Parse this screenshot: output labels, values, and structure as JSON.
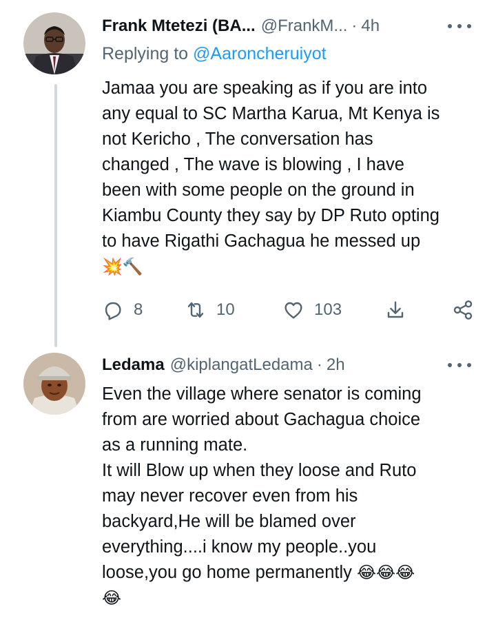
{
  "tweets": [
    {
      "display_name": "Frank Mtetezi (BA...",
      "handle": "@FrankM...",
      "separator": "·",
      "time": "4h",
      "reply_prefix": "Replying to ",
      "reply_to": "@Aaroncheruiyot",
      "text": "Jamaa you are speaking as if you are into\nany equal to SC Martha Karua, Mt Kenya is\nnot Kericho , The conversation has\nchanged , The wave is blowing , I have\nbeen with some people on the ground in\nKiambu County they say by DP Ruto opting\nto have Rigathi Gachagua he messed up",
      "emoji": "💥🔨",
      "replies": "8",
      "retweets": "10",
      "likes": "103"
    },
    {
      "display_name": "Ledama",
      "handle": "@kiplangatLedama",
      "separator": "·",
      "time": "2h",
      "text": "Even the village where senator is coming\nfrom are worried about Gachagua choice\nas a running mate.\nIt will Blow up when they loose and Ruto\nmay never recover even from his\nbackyard,He will be blamed over\neverything....i know my people..you\nloose,you go home permanently ",
      "emoji": "😂😂😂",
      "emoji_last_line": "😂"
    }
  ],
  "icons": {
    "reply": "reply-icon",
    "retweet": "retweet-icon",
    "like": "heart-icon",
    "share": "share-icon",
    "analytics": "download-icon",
    "more": "more-icon"
  },
  "colors": {
    "link": "#1d9bf0",
    "secondary_text": "#536471",
    "thread_line": "#cfd9de"
  }
}
